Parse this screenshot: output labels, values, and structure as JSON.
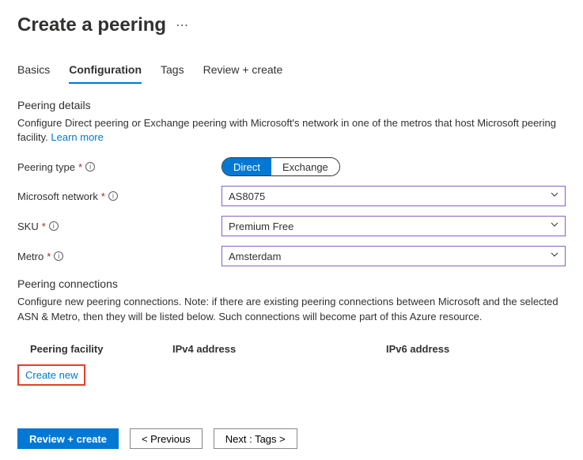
{
  "header": {
    "title": "Create a peering"
  },
  "tabs": {
    "basics": "Basics",
    "configuration": "Configuration",
    "tags": "Tags",
    "review": "Review + create"
  },
  "details": {
    "title": "Peering details",
    "desc": "Configure Direct peering or Exchange peering with Microsoft's network in one of the metros that host Microsoft peering facility. ",
    "learn_more": "Learn more"
  },
  "form": {
    "peering_type_label": "Peering type",
    "peering_type_opt1": "Direct",
    "peering_type_opt2": "Exchange",
    "ms_network_label": "Microsoft network",
    "ms_network_value": "AS8075",
    "sku_label": "SKU",
    "sku_value": "Premium Free",
    "metro_label": "Metro",
    "metro_value": "Amsterdam"
  },
  "connections": {
    "title": "Peering connections",
    "desc": "Configure new peering connections. Note: if there are existing peering connections between Microsoft and the selected ASN & Metro, then they will be listed below. Such connections will become part of this Azure resource.",
    "col_facility": "Peering facility",
    "col_ipv4": "IPv4 address",
    "col_ipv6": "IPv6 address",
    "create_new": "Create new"
  },
  "footer": {
    "review": "Review + create",
    "previous": "< Previous",
    "next": "Next : Tags >"
  }
}
